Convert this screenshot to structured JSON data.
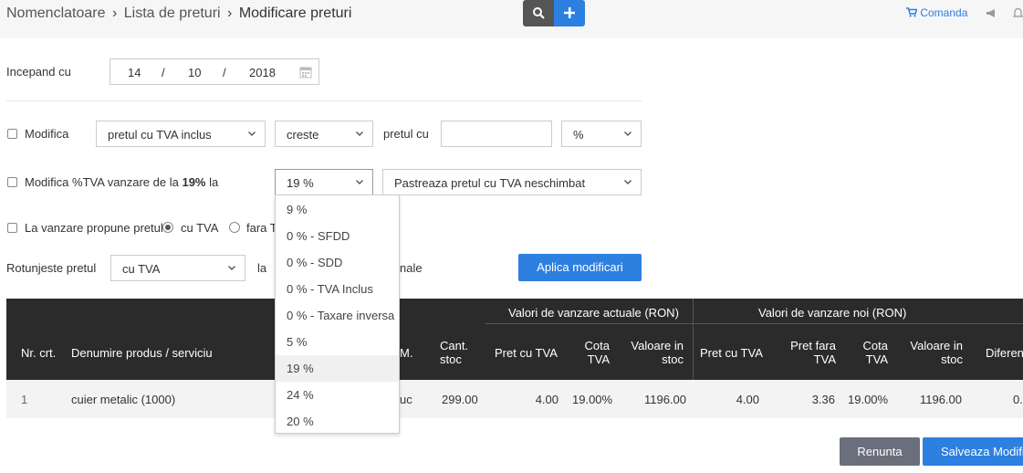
{
  "breadcrumb": {
    "item1": "Nomenclatoare",
    "item2": "Lista de preturi",
    "item3": "Modificare preturi",
    "sep": "›"
  },
  "header": {
    "search_icon": "search-icon",
    "add_icon": "plus-icon",
    "comanda_label": "Comanda",
    "megaphone_icon": "megaphone-icon",
    "bell_icon": "bell-icon"
  },
  "form": {
    "start_label": "Incepand cu",
    "date": {
      "day": "14",
      "month": "10",
      "year": "2018",
      "sep": "/"
    },
    "modify": {
      "label": "Modifica",
      "price_type": "pretul cu TVA inclus",
      "direction": "creste",
      "by_label": "pretul cu",
      "amount": "",
      "unit": "%"
    },
    "vat": {
      "label_prefix": "Modifica %TVA vanzare de la",
      "current": "19%",
      "label_suffix": "la",
      "new_vat": "19 %",
      "policy": "Pastreaza pretul cu TVA neschimbat"
    },
    "propose": {
      "label": "La vanzare propune pretul",
      "opt1": "cu TVA",
      "opt2": "fara T"
    },
    "round": {
      "label": "Rotunjeste pretul",
      "value": "cu TVA",
      "to_label": "la",
      "suffix": "nale"
    },
    "apply_label": "Aplica modificari"
  },
  "dropdown": {
    "options": [
      "9 %",
      "0 % - SFDD",
      "0 % - SDD",
      "0 % - TVA Inclus",
      "0 % - Taxare inversa",
      "5 %",
      "19 %",
      "24 %",
      "20 %"
    ],
    "highlighted": "19 %"
  },
  "table": {
    "group_current": "Valori de vanzare actuale (RON)",
    "group_new": "Valori de vanzare noi (RON)",
    "col_nr": "Nr. crt.",
    "col_name": "Denumire produs / serviciu",
    "col_um": "M.",
    "col_qty_1": "Cant.",
    "col_qty_2": "stoc",
    "col_cur_price": "Pret cu TVA",
    "col_cur_vat_1": "Cota",
    "col_cur_vat_2": "TVA",
    "col_cur_value_1": "Valoare in",
    "col_cur_value_2": "stoc",
    "col_new_price": "Pret cu TVA",
    "col_new_net_1": "Pret fara",
    "col_new_net_2": "TVA",
    "col_new_vat_1": "Cota",
    "col_new_vat_2": "TVA",
    "col_new_value_1": "Valoare in",
    "col_new_value_2": "stoc",
    "col_diff": "Diferen",
    "rows": [
      {
        "nr": "1",
        "name": "cuier metalic (1000)",
        "um": "uc",
        "qty": "299.00",
        "cur_price": "4.00",
        "cur_vat": "19.00%",
        "cur_value": "1196.00",
        "new_price": "4.00",
        "new_net": "3.36",
        "new_vat": "19.00%",
        "new_value": "1196.00",
        "diff": "0."
      }
    ]
  },
  "actions": {
    "cancel": "Renunta",
    "save": "Salveaza Modific"
  }
}
